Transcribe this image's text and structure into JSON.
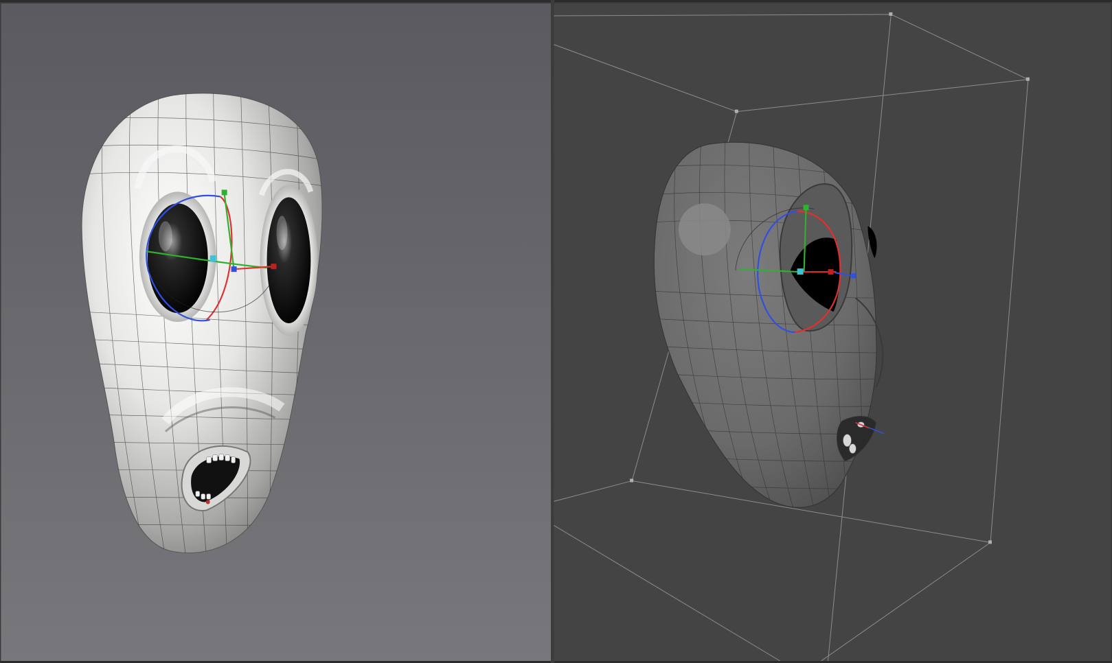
{
  "viewports": [
    {
      "id": "perspective-left",
      "label": ""
    },
    {
      "id": "perspective-right",
      "label": ""
    }
  ],
  "colors": {
    "left_background_top": "#5a5a60",
    "left_background_bottom": "#75757b",
    "right_background": "#444444",
    "gizmo_x": "#e03030",
    "gizmo_y": "#30b030",
    "gizmo_z": "#3050e0",
    "gizmo_center": "#40c0d0",
    "bounding_box": "#9a9a9a"
  },
  "scene": {
    "object": "alien-head-mesh",
    "display_left": "smooth-shaded-with-wireframe",
    "display_right": "flat-shaded-with-wireframe",
    "manipulator": "rotate-gizmo"
  }
}
